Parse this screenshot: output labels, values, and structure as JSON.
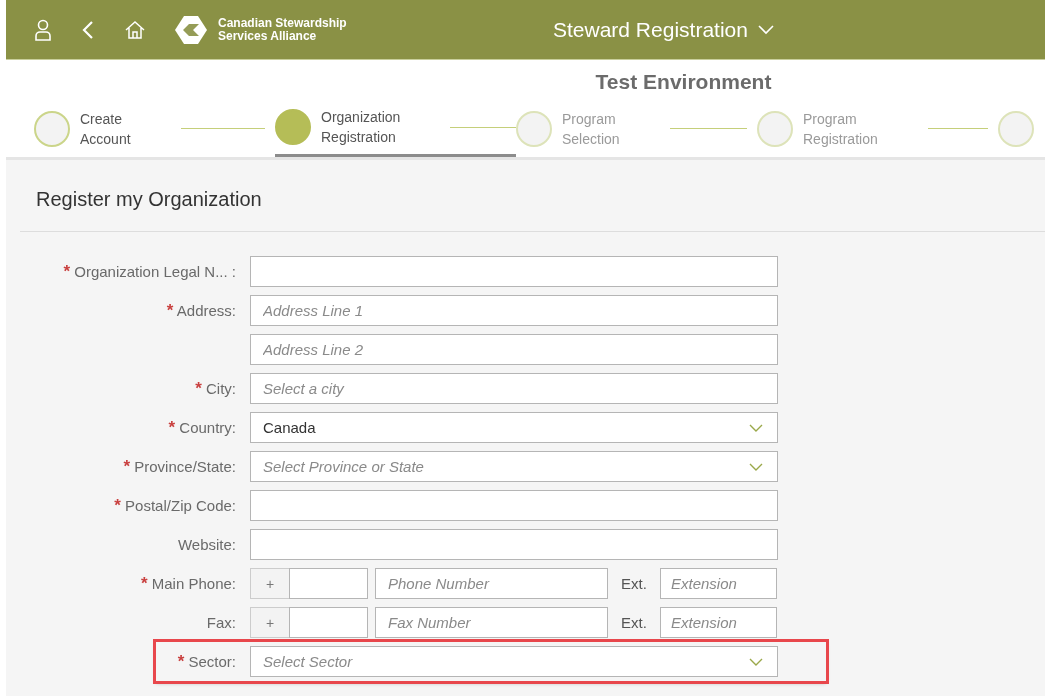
{
  "header": {
    "logo_text": [
      "Canadian Stewardship",
      "Services Alliance"
    ],
    "title": "Steward Registration"
  },
  "environment": "Test Environment",
  "steps": [
    {
      "label": "Create Account",
      "selected": false,
      "visited": true
    },
    {
      "label": "Organization Registration",
      "selected": true,
      "visited": true
    },
    {
      "label": "Program Selection",
      "selected": false,
      "visited": false
    },
    {
      "label": "Program Registration",
      "selected": false,
      "visited": false
    },
    {
      "selected": false,
      "visited": false
    }
  ],
  "section_title": "Register my Organization",
  "fields": [
    {
      "kind": "text",
      "label": "Organization Legal N... :",
      "required_mark": "*"
    },
    {
      "kind": "text",
      "label": "Address:",
      "required_mark": "*",
      "placeholder": "Address Line 1"
    },
    {
      "kind": "text",
      "placeholder": "Address Line 2"
    },
    {
      "kind": "text",
      "label": "City:",
      "required_mark": "*",
      "placeholder": "Select a city"
    },
    {
      "kind": "select",
      "label": "Country:",
      "required_mark": "*",
      "value": "Canada"
    },
    {
      "kind": "select",
      "label": "Province/State:",
      "required_mark": "*",
      "placeholder": "Select Province or State"
    },
    {
      "kind": "text",
      "label": "Postal/Zip Code:",
      "required_mark": "*"
    },
    {
      "kind": "text",
      "label": "Website:"
    },
    {
      "kind": "phone",
      "label": "Main Phone:",
      "required_mark": "*",
      "prefix": "+",
      "number_placeholder": "Phone Number",
      "ext_label": "Ext.",
      "ext_placeholder": "Extension"
    },
    {
      "kind": "phone",
      "label": "Fax:",
      "prefix": "+",
      "number_placeholder": "Fax Number",
      "ext_label": "Ext.",
      "ext_placeholder": "Extension"
    },
    {
      "kind": "select",
      "label": "Sector:",
      "required_mark": "*",
      "placeholder": "Select Sector",
      "highlighted": true
    }
  ]
}
